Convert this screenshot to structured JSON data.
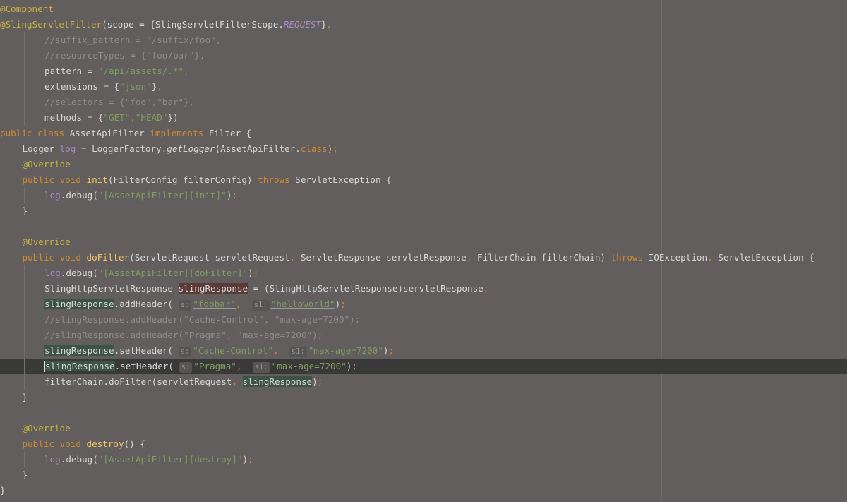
{
  "editor": {
    "background": "#625e5e",
    "current_line_background": "#3a3939",
    "colors": {
      "keyword": "#d08a2f",
      "annotation": "#c8b23e",
      "string": "#7f9d5c",
      "comment": "#8d8a8a",
      "field": "#a58bc2",
      "text": "#d6d6d6"
    },
    "lines": [
      {
        "indent": 0,
        "tokens": [
          {
            "t": "@Component",
            "c": "ann"
          }
        ]
      },
      {
        "indent": 0,
        "tokens": [
          {
            "t": "@SlingServletFilter",
            "c": "ann"
          },
          {
            "t": "(scope = {SlingServletFilterScope."
          },
          {
            "t": "REQUEST",
            "c": "fld italic"
          },
          {
            "t": "}"
          },
          {
            "t": ",",
            "c": "kw"
          }
        ]
      },
      {
        "indent": 2,
        "tokens": [
          {
            "t": "//suffix_pattern = \"/suffix/foo\",",
            "c": "cmt"
          }
        ]
      },
      {
        "indent": 2,
        "tokens": [
          {
            "t": "//resourceTypes = {\"foo/bar\"},",
            "c": "cmt"
          }
        ]
      },
      {
        "indent": 2,
        "tokens": [
          {
            "t": "pattern = "
          },
          {
            "t": "\"/api/assets/.*\"",
            "c": "str"
          },
          {
            "t": ",",
            "c": "kw"
          }
        ]
      },
      {
        "indent": 2,
        "tokens": [
          {
            "t": "extensions = {"
          },
          {
            "t": "\"json\"",
            "c": "str"
          },
          {
            "t": "}"
          },
          {
            "t": ",",
            "c": "kw"
          }
        ]
      },
      {
        "indent": 2,
        "tokens": [
          {
            "t": "//selectors = {\"foo\",\"bar\"},",
            "c": "cmt"
          }
        ]
      },
      {
        "indent": 2,
        "tokens": [
          {
            "t": "methods = {"
          },
          {
            "t": "\"GET\"",
            "c": "str"
          },
          {
            "t": ",",
            "c": "kw"
          },
          {
            "t": "\"HEAD\"",
            "c": "str"
          },
          {
            "t": "})"
          }
        ]
      },
      {
        "indent": 0,
        "tokens": [
          {
            "t": "public class ",
            "c": "kw"
          },
          {
            "t": "AssetApiFilter "
          },
          {
            "t": "implements ",
            "c": "kw"
          },
          {
            "t": "Filter {"
          }
        ]
      },
      {
        "indent": 1,
        "tokens": [
          {
            "t": "Logger "
          },
          {
            "t": "log",
            "c": "fld"
          },
          {
            "t": " = LoggerFactory."
          },
          {
            "t": "getLogger",
            "c": "italic"
          },
          {
            "t": "(AssetApiFilter."
          },
          {
            "t": "class",
            "c": "kw"
          },
          {
            "t": ")"
          },
          {
            "t": ";",
            "c": "kw"
          }
        ]
      },
      {
        "indent": 1,
        "tokens": [
          {
            "t": "@Override",
            "c": "ann"
          }
        ]
      },
      {
        "indent": 1,
        "tokens": [
          {
            "t": "public void ",
            "c": "kw"
          },
          {
            "t": "init",
            "c": "meth"
          },
          {
            "t": "(FilterConfig filterConfig) "
          },
          {
            "t": "throws ",
            "c": "kw"
          },
          {
            "t": "ServletException {"
          }
        ]
      },
      {
        "indent": 2,
        "tokens": [
          {
            "t": "log",
            "c": "fld"
          },
          {
            "t": ".debug("
          },
          {
            "t": "\"[AssetApiFilter][init]\"",
            "c": "str"
          },
          {
            "t": ")"
          },
          {
            "t": ";",
            "c": "kw"
          }
        ]
      },
      {
        "indent": 1,
        "tokens": [
          {
            "t": "}"
          }
        ]
      },
      {
        "indent": 0,
        "tokens": []
      },
      {
        "indent": 1,
        "tokens": [
          {
            "t": "@Override",
            "c": "ann"
          }
        ]
      },
      {
        "indent": 1,
        "tokens": [
          {
            "t": "public void ",
            "c": "kw"
          },
          {
            "t": "doFilter",
            "c": "meth"
          },
          {
            "t": "(ServletRequest servletRequest"
          },
          {
            "t": ", ",
            "c": "kw"
          },
          {
            "t": "ServletResponse servletResponse"
          },
          {
            "t": ", ",
            "c": "kw"
          },
          {
            "t": "FilterChain filterChain) "
          },
          {
            "t": "throws ",
            "c": "kw"
          },
          {
            "t": "IOException"
          },
          {
            "t": ", ",
            "c": "kw"
          },
          {
            "t": "ServletException {"
          }
        ]
      },
      {
        "indent": 2,
        "tokens": [
          {
            "t": "log",
            "c": "fld"
          },
          {
            "t": ".debug("
          },
          {
            "t": "\"[AssetApiFilter][doFilter]\"",
            "c": "str"
          },
          {
            "t": ")"
          },
          {
            "t": ";",
            "c": "kw"
          }
        ]
      },
      {
        "indent": 2,
        "tokens": [
          {
            "t": "SlingHttpServletResponse "
          },
          {
            "t": "slingResponse",
            "c": "hl-write"
          },
          {
            "t": " = (SlingHttpServletResponse)servletResponse"
          },
          {
            "t": ";",
            "c": "kw"
          }
        ]
      },
      {
        "indent": 2,
        "tokens": [
          {
            "t": "slingResponse",
            "c": "hl-read"
          },
          {
            "t": ".addHeader( "
          },
          {
            "t": "s:",
            "hint": true
          },
          {
            "t": "\"foobar\"",
            "c": "str underline"
          },
          {
            "t": ",  ",
            "c": "kw"
          },
          {
            "t": "s1:",
            "hint": true
          },
          {
            "t": "\"helloworld\"",
            "c": "str underline"
          },
          {
            "t": ")"
          },
          {
            "t": ";",
            "c": "kw"
          }
        ]
      },
      {
        "indent": 2,
        "tokens": [
          {
            "t": "//slingResponse.addHeader(\"Cache-Control\", \"max-age=7200\");",
            "c": "cmt"
          }
        ]
      },
      {
        "indent": 2,
        "tokens": [
          {
            "t": "//slingResponse.addHeader(\"Pragma\", \"max-age=7200\");",
            "c": "cmt"
          }
        ]
      },
      {
        "indent": 2,
        "tokens": [
          {
            "t": "slingResponse",
            "c": "hl-read"
          },
          {
            "t": ".setHeader( "
          },
          {
            "t": "s:",
            "hint": true
          },
          {
            "t": "\"Cache-Control\"",
            "c": "str"
          },
          {
            "t": ",  ",
            "c": "kw"
          },
          {
            "t": "s1:",
            "hint": true
          },
          {
            "t": "\"max-age=7200\"",
            "c": "str"
          },
          {
            "t": ")"
          },
          {
            "t": ";",
            "c": "kw"
          }
        ]
      },
      {
        "indent": 2,
        "current": true,
        "caret": true,
        "tokens": [
          {
            "t": "slingResponse",
            "c": "hl-read"
          },
          {
            "t": ".setHeader( "
          },
          {
            "t": "s:",
            "hint": true
          },
          {
            "t": "\"Pragma\"",
            "c": "str"
          },
          {
            "t": ",  ",
            "c": "kw"
          },
          {
            "t": "s1:",
            "hint": true
          },
          {
            "t": "\"max-age=7200\"",
            "c": "str"
          },
          {
            "t": ")"
          },
          {
            "t": ";",
            "c": "kw"
          }
        ]
      },
      {
        "indent": 2,
        "tokens": [
          {
            "t": "filterChain.doFilter(servletRequest"
          },
          {
            "t": ", ",
            "c": "kw"
          },
          {
            "t": "slingResponse",
            "c": "hl-read"
          },
          {
            "t": ")"
          },
          {
            "t": ";",
            "c": "kw"
          }
        ]
      },
      {
        "indent": 1,
        "tokens": [
          {
            "t": "}"
          }
        ]
      },
      {
        "indent": 0,
        "tokens": []
      },
      {
        "indent": 1,
        "tokens": [
          {
            "t": "@Override",
            "c": "ann"
          }
        ]
      },
      {
        "indent": 1,
        "tokens": [
          {
            "t": "public void ",
            "c": "kw"
          },
          {
            "t": "destroy",
            "c": "meth"
          },
          {
            "t": "() {"
          }
        ]
      },
      {
        "indent": 2,
        "tokens": [
          {
            "t": "log",
            "c": "fld"
          },
          {
            "t": ".debug("
          },
          {
            "t": "\"[AssetApiFilter][destroy]\"",
            "c": "str"
          },
          {
            "t": ")"
          },
          {
            "t": ";",
            "c": "kw"
          }
        ]
      },
      {
        "indent": 1,
        "tokens": [
          {
            "t": "}"
          }
        ]
      },
      {
        "indent": 0,
        "tokens": [
          {
            "t": "}"
          }
        ]
      }
    ]
  }
}
